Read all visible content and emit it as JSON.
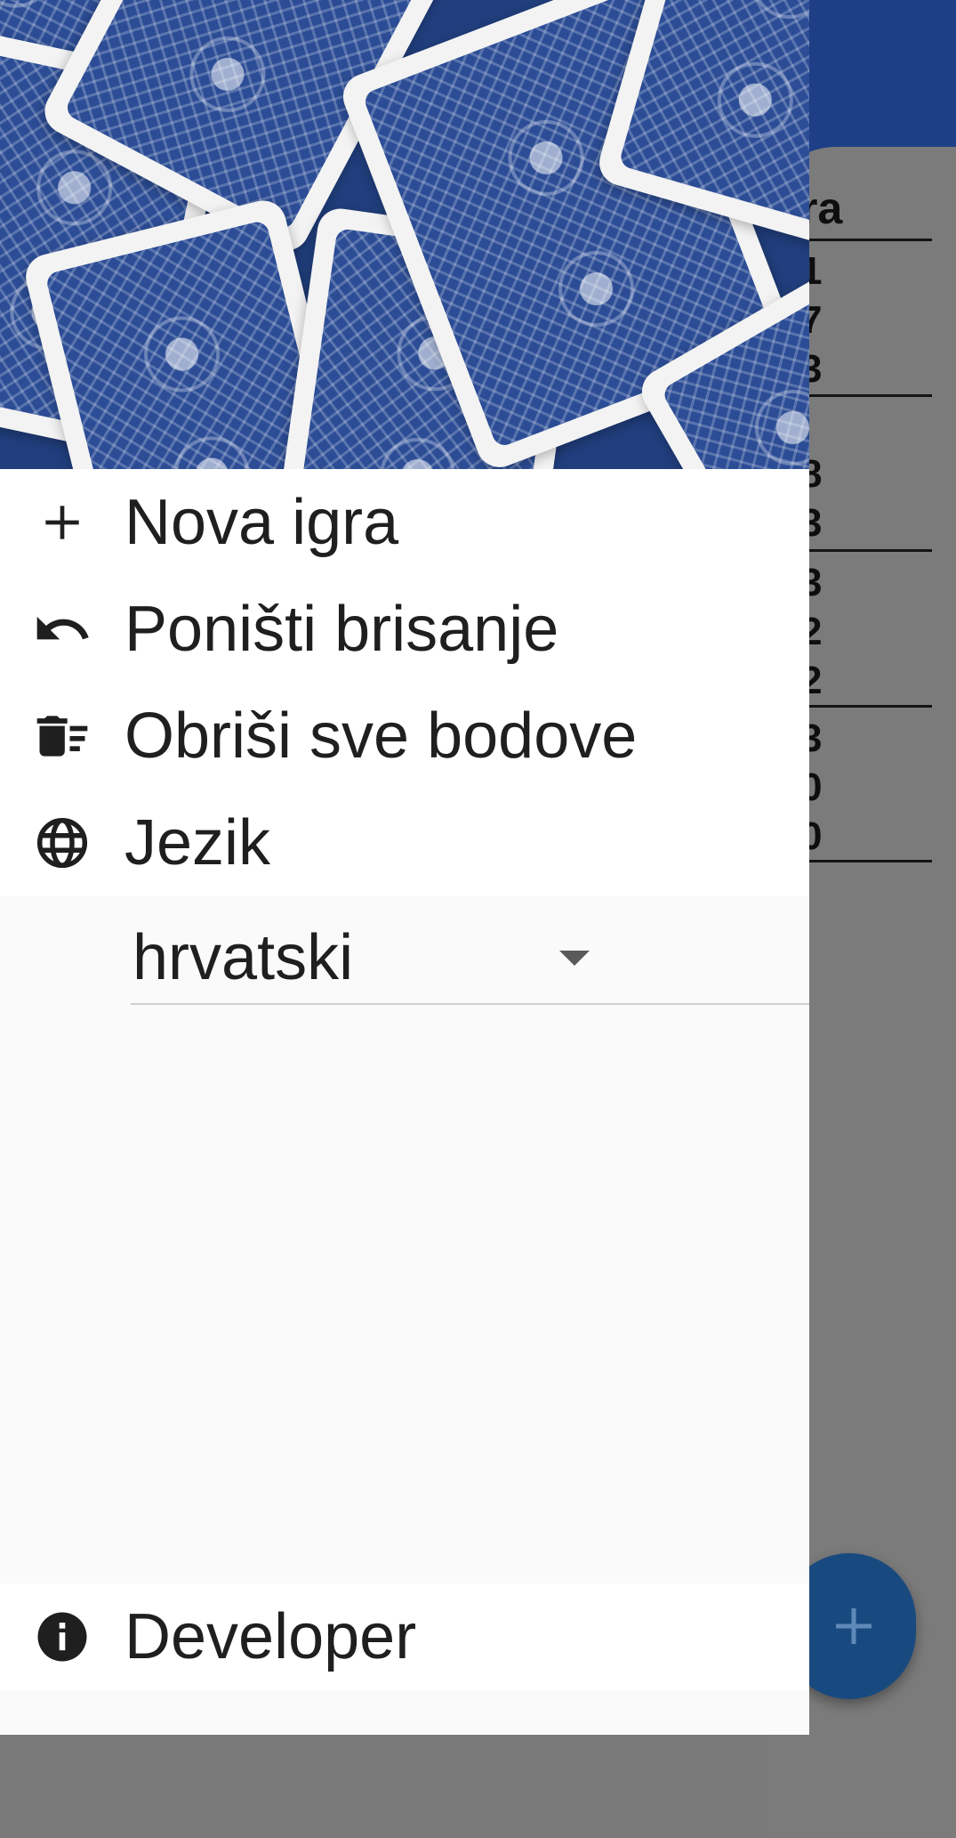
{
  "background": {
    "column_header": "ra",
    "groups": [
      [
        "1",
        "7",
        "3"
      ],
      [
        "",
        "8",
        "3"
      ],
      [
        "3",
        "2",
        "2"
      ],
      [
        "3",
        "0",
        "0"
      ]
    ],
    "fab_icon": "plus-icon"
  },
  "drawer": {
    "menu": [
      {
        "icon": "plus-icon",
        "label": "Nova igra"
      },
      {
        "icon": "undo-icon",
        "label": "Poništi brisanje"
      },
      {
        "icon": "delete-sweep-icon",
        "label": "Obriši sve bodove"
      },
      {
        "icon": "globe-icon",
        "label": "Jezik"
      }
    ],
    "language": {
      "selected": "hrvatski",
      "icon": "arrow-drop-down-icon"
    },
    "footer": {
      "icon": "info-icon",
      "label": "Developer"
    }
  },
  "colors": {
    "app_bar": "#1e3f86",
    "scrim": "#7a7a7a",
    "fab": "#184a80",
    "card_back": "#2c4d96",
    "drawer_bg": "#fafafa"
  }
}
